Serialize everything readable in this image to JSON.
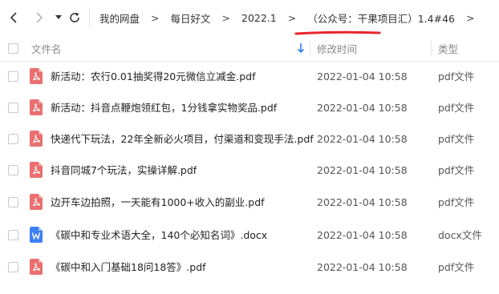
{
  "breadcrumb": [
    {
      "label": "我的网盘"
    },
    {
      "label": "每日好文"
    },
    {
      "label": "2022.1"
    },
    {
      "label": "（公众号：干果项目汇）1.4#46"
    }
  ],
  "header": {
    "name": "文件名",
    "modified": "修改时间",
    "type": "类型"
  },
  "files": [
    {
      "name": "新活动：农行0.01抽奖得20元微信立减金.pdf",
      "modified": "2022-01-04 10:58",
      "type": "pdf文件",
      "icon": "pdf-icon"
    },
    {
      "name": "新活动：抖音点鞭炮领红包，1分钱拿实物奖品.pdf",
      "modified": "2022-01-04 10:58",
      "type": "pdf文件",
      "icon": "pdf-icon"
    },
    {
      "name": "快递代下玩法，22年全新必火项目，付渠道和变现手法.pdf",
      "modified": "2022-01-04 10:58",
      "type": "pdf文件",
      "icon": "pdf-icon"
    },
    {
      "name": "抖音同城7个玩法，实操详解.pdf",
      "modified": "2022-01-04 10:58",
      "type": "pdf文件",
      "icon": "pdf-icon"
    },
    {
      "name": "边开车边拍照，一天能有1000+收入的副业.pdf",
      "modified": "2022-01-04 10:58",
      "type": "pdf文件",
      "icon": "pdf-icon"
    },
    {
      "name": "《碳中和专业术语大全，140个必知名词》.docx",
      "modified": "2022-01-04 10:58",
      "type": "docx文件",
      "icon": "word-icon"
    },
    {
      "name": "《碳中和入门基础18问18答》.pdf",
      "modified": "2022-01-04 10:58",
      "type": "pdf文件",
      "icon": "pdf-icon"
    }
  ],
  "colors": {
    "pdf": "#ea6f6f",
    "word": "#3f7ff5",
    "accent": "#2b7cf0",
    "annotation": "#e8242b"
  }
}
